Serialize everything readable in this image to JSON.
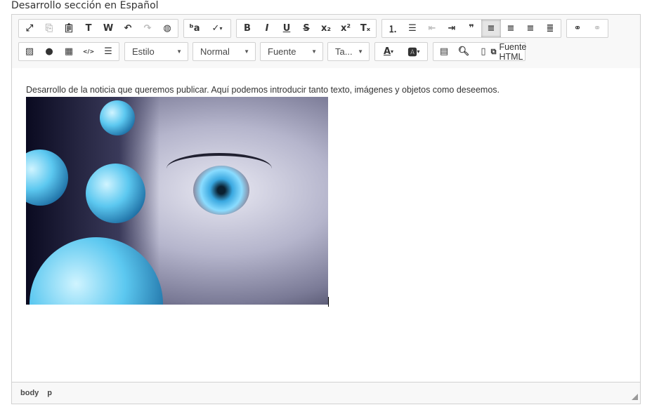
{
  "section_title": "Desarrollo sección en Español",
  "toolbar": {
    "row1": [
      [
        {
          "icon": "maximize-icon"
        },
        {
          "icon": "copy-icon",
          "disabled": true
        },
        {
          "icon": "paste-icon"
        },
        {
          "icon": "paste-text-icon"
        },
        {
          "icon": "paste-word-icon"
        },
        {
          "icon": "undo-icon"
        },
        {
          "icon": "redo-icon",
          "disabled": true
        },
        {
          "icon": "globe-icon"
        }
      ],
      [
        {
          "icon": "find-replace-icon"
        },
        {
          "icon": "spellcheck-icon",
          "dropdown": true
        }
      ],
      [
        {
          "icon": "bold-icon"
        },
        {
          "icon": "italic-icon"
        },
        {
          "icon": "underline-icon"
        },
        {
          "icon": "strikethrough-icon"
        },
        {
          "icon": "subscript-icon"
        },
        {
          "icon": "superscript-icon"
        },
        {
          "icon": "remove-format-icon"
        }
      ],
      [
        {
          "icon": "numbered-list-icon"
        },
        {
          "icon": "bulleted-list-icon"
        },
        {
          "icon": "outdent-icon",
          "disabled": true
        },
        {
          "icon": "indent-icon"
        },
        {
          "icon": "blockquote-icon"
        },
        {
          "icon": "align-left-icon",
          "active": true
        },
        {
          "icon": "align-center-icon"
        },
        {
          "icon": "align-right-icon"
        },
        {
          "icon": "align-justify-icon"
        }
      ],
      [
        {
          "icon": "link-icon"
        },
        {
          "icon": "unlink-icon",
          "disabled": true
        }
      ]
    ],
    "row2_group1": [
      {
        "icon": "image-icon"
      },
      {
        "icon": "flash-icon"
      },
      {
        "icon": "table-icon"
      },
      {
        "icon": "div-icon"
      },
      {
        "icon": "horizontal-rule-icon"
      }
    ],
    "combos": [
      {
        "label": "Estilo",
        "width": 91
      },
      {
        "label": "Normal",
        "width": 90
      },
      {
        "label": "Fuente",
        "width": 90
      },
      {
        "label": "Ta...",
        "width": 60
      }
    ],
    "colors": [
      {
        "icon": "text-color-icon",
        "dropdown": true
      },
      {
        "icon": "background-color-icon",
        "dropdown": true
      }
    ],
    "row2_group3": [
      {
        "icon": "show-blocks-icon"
      },
      {
        "icon": "preview-icon"
      },
      {
        "icon": "templates-icon"
      }
    ],
    "source_label": "Fuente HTML"
  },
  "content": {
    "paragraph": "Desarrollo de la noticia que queremos publicar. Aquí podemos introducir tanto texto, imágenes y objetos como deseemos."
  },
  "footer": {
    "path": [
      "body",
      "p"
    ]
  }
}
